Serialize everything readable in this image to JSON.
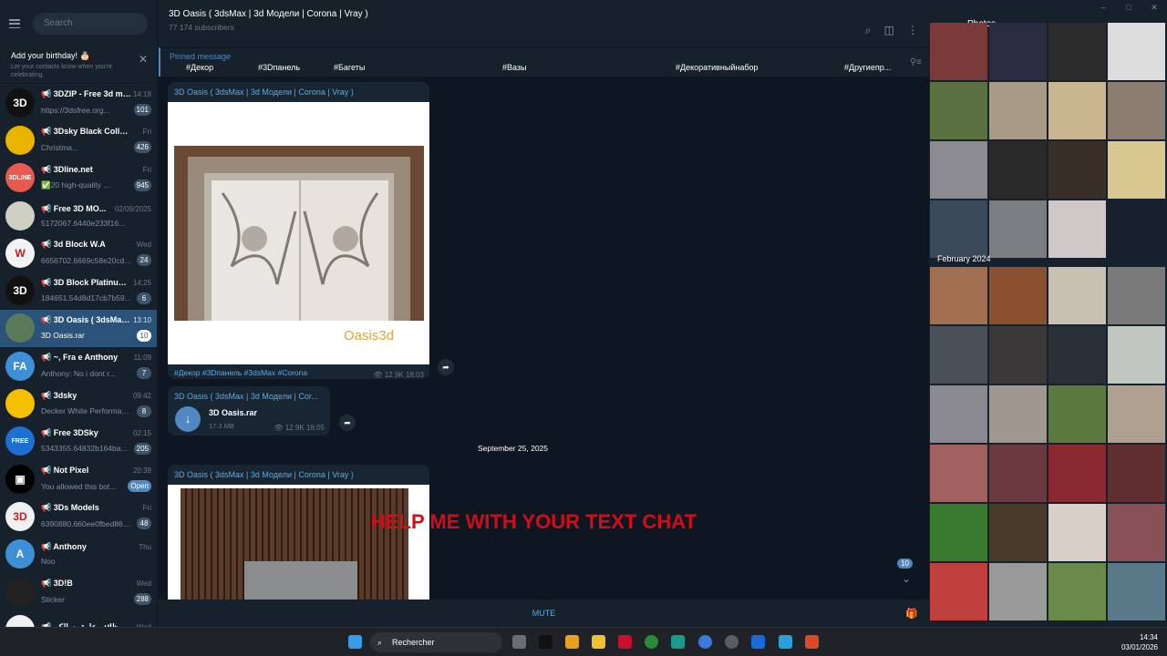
{
  "window_controls": [
    "–",
    "□",
    "✕"
  ],
  "sidebar": {
    "search_placeholder": "Search",
    "birthday": {
      "title": "Add your birthday! 🎂",
      "subtitle": "Let your contacts know when you're celebrating."
    },
    "chats": [
      {
        "name": "3DZIP - Free 3d mo...",
        "time": "14:18",
        "msg": "https://3dsfree.org...",
        "badge": "101",
        "avatar_text": "3D",
        "avatar_color": "#111111"
      },
      {
        "name": "3Dsky Black Collectio...",
        "time": "Fri",
        "msg": "Christma...",
        "badge": "426",
        "avatar_text": "",
        "avatar_color": "#e8b400"
      },
      {
        "name": "3Dline.net",
        "time": "Fri",
        "msg": "✅20 high-quality ...",
        "badge": "945",
        "avatar_text": "3DLINE",
        "avatar_color": "#e85a4f"
      },
      {
        "name": "Free 3D MO...",
        "time": "02/09/2025",
        "msg": "5172067.6440e233f16...",
        "badge": "",
        "avatar_text": "",
        "avatar_color": "#cfcfc4"
      },
      {
        "name": "3d Block W.A",
        "time": "Wed",
        "msg": "6656702.6669c58e20cd0...",
        "badge": "24",
        "avatar_text": "W",
        "avatar_color": "#f2f2f2"
      },
      {
        "name": "3D Block Platinum...",
        "time": "14:25",
        "msg": "184651.54d8d17cb7b59...",
        "badge": "6",
        "avatar_text": "3D",
        "avatar_color": "#111111"
      },
      {
        "name": "3D Oasis ( 3dsMax ...",
        "time": "13:10",
        "msg": "3D Oasis.rar",
        "badge": "10",
        "avatar_text": "",
        "avatar_color": "#5a7a5a"
      },
      {
        "name": "~, Fra e Anthony",
        "time": "11:09",
        "msg": "Anthony: No i dont r...",
        "badge": "7",
        "avatar_text": "FA",
        "avatar_color": "#3f8fd6"
      },
      {
        "name": "3dsky",
        "time": "09:42",
        "msg": "Decker White Performan...",
        "badge": "8",
        "avatar_text": "",
        "avatar_color": "#f4c000"
      },
      {
        "name": "Free 3DSky",
        "time": "02:15",
        "msg": "5343355.64832b164ba...",
        "badge": "205",
        "avatar_text": "FREE",
        "avatar_color": "#1d6fd1"
      },
      {
        "name": "Not Pixel",
        "time": "20:39",
        "msg": "You allowed this bot...",
        "badge": "Open",
        "avatar_text": "▣",
        "avatar_color": "#000000"
      },
      {
        "name": "3Ds Models",
        "time": "Fri",
        "msg": "6390880.660ee0fbed864...",
        "badge": "48",
        "avatar_text": "3D",
        "avatar_color": "#f0f0f0"
      },
      {
        "name": "Anthony",
        "time": "Thu",
        "msg": "Noo",
        "badge": "",
        "avatar_text": "A",
        "avatar_color": "#3f8fd6"
      },
      {
        "name": "3D!B",
        "time": "Wed",
        "msg": "Sticker",
        "badge": "288",
        "avatar_text": "",
        "avatar_color": "#222222"
      },
      {
        "name": "وظائف عامة بسالكم ...",
        "time": "Wed",
        "msg": "",
        "badge": "",
        "avatar_text": "",
        "avatar_color": "#f0f0f0"
      }
    ]
  },
  "channel": {
    "title": "3D Oasis ( 3dsMax | 3d Модели | Corona | Vray )",
    "subscribers": "77 174 subscribers",
    "pinned_label": "Pinned message",
    "pinned_tags": [
      "#Декор",
      "#3Dпанель",
      "#Багеты",
      "#Вазы",
      "#Декоративныйнабор",
      "#Другиепр..."
    ],
    "posts": [
      {
        "author": "3D Oasis ( 3dsMax | 3d Модели | Corona | Vray )",
        "watermark": "Oasis3d",
        "caption": "#Декор #3Dпанель #3dsMax #Corona",
        "views": "12.9K",
        "time": "18:03"
      },
      {
        "author": "3D Oasis ( 3dsMax | 3d Модели | Cor...",
        "file_name": "3D Oasis.rar",
        "file_size": "17.3 MB",
        "views": "12.9K",
        "time": "18:05"
      },
      {
        "author": "3D Oasis ( 3dsMax | 3d Модели | Corona | Vray )"
      }
    ],
    "date_separator": "September 25, 2025",
    "overlay_text": "HELP ME WITH YOUR TEXT CHAT",
    "mute_label": "MUTE",
    "unread_badge": "10"
  },
  "photos_panel": {
    "title": "Photos",
    "month_label": "February 2024",
    "thumbs_top": [
      "#7a3a3a",
      "#2a2a40",
      "#2c2c2c",
      "#dcdcdc",
      "#5a7040",
      "#a89a86",
      "#c9b590",
      "#8a7e70",
      "#8c8c90",
      "#2a2a2a",
      "#3a2e28",
      "#d8c890",
      "#3a4a5a",
      "#7a7e80",
      "#d0c8c8"
    ],
    "thumbs_bottom": [
      "#a07050",
      "#8a5030",
      "#c8c0b0",
      "#7a7a7a",
      "#4a5058",
      "#3a3838",
      "#2a3038",
      "#c0c8c0",
      "#8a8a90",
      "#a09890",
      "#5a7a40",
      "#b0a090",
      "#a06060",
      "#6a3a40",
      "#8a2a30",
      "#603030",
      "#3a7a30",
      "#4a3a2a",
      "#d8d0c8",
      "#8a5058",
      "#c04040",
      "#9a9a9a",
      "#6a8a4a",
      "#5a7a8a"
    ]
  },
  "taskbar": {
    "search_label": "Rechercher",
    "time": "14:34",
    "date": "03/01/2026"
  }
}
